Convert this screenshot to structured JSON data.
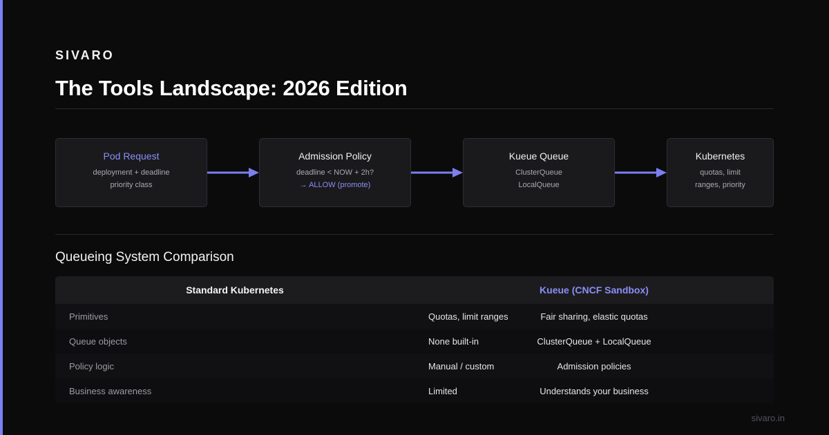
{
  "brand": "SIVARO",
  "title": "The Tools Landscape: 2026 Edition",
  "flow": {
    "nodes": [
      {
        "title": "Pod Request",
        "lines": [
          "deployment + deadline",
          "priority class"
        ]
      },
      {
        "title": "Admission Policy",
        "lines": [
          "deadline < NOW + 2h?",
          "→ ALLOW (promote)"
        ]
      },
      {
        "title": "Kueue Queue",
        "lines": [
          "ClusterQueue",
          "LocalQueue"
        ]
      },
      {
        "title": "Kubernetes",
        "lines": [
          "quotas, limit",
          "ranges, priority"
        ]
      }
    ]
  },
  "comparison": {
    "title": "Queueing System Comparison",
    "headers": [
      "Standard Kubernetes",
      "Kueue (CNCF Sandbox)"
    ],
    "rows": [
      {
        "label": "Primitives",
        "standard": "Quotas, limit ranges",
        "kueue": "Fair sharing, elastic quotas"
      },
      {
        "label": "Queue objects",
        "standard": "None built-in",
        "kueue": "ClusterQueue + LocalQueue"
      },
      {
        "label": "Policy logic",
        "standard": "Manual / custom",
        "kueue": "Admission policies"
      },
      {
        "label": "Business awareness",
        "standard": "Limited",
        "kueue": "Understands your business"
      }
    ]
  },
  "footer": "sivaro.in",
  "colors": {
    "accent": "#7b7ff0",
    "accent_text": "#8b8ff5",
    "background": "#0b0b0c"
  }
}
